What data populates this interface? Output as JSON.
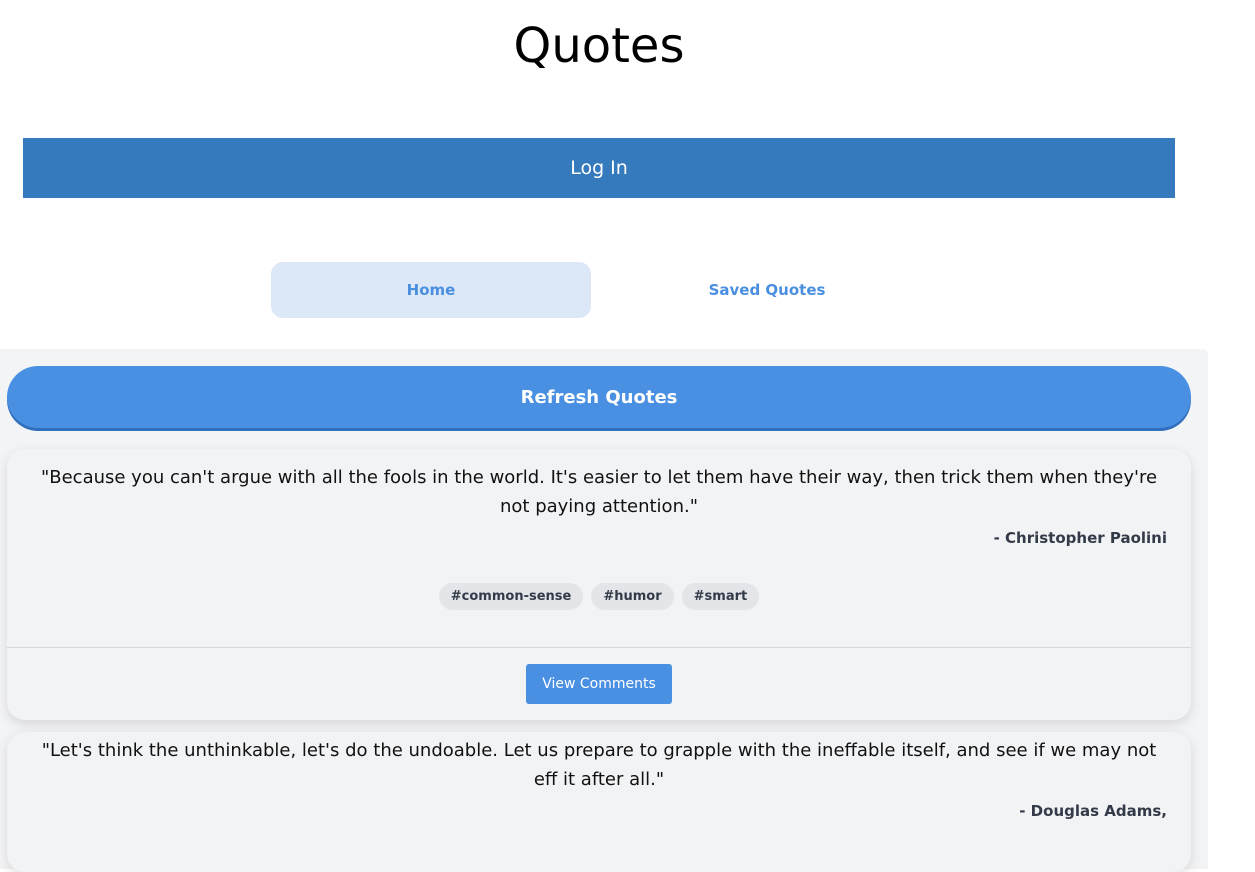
{
  "header": {
    "title": "Quotes",
    "login_label": "Log In"
  },
  "nav": {
    "tabs": [
      {
        "label": "Home",
        "active": true
      },
      {
        "label": "Saved Quotes",
        "active": false
      }
    ]
  },
  "main": {
    "refresh_label": "Refresh Quotes",
    "quotes": [
      {
        "text": "\"Because you can't argue with all the fools in the world. It's easier to let them have their way, then trick them when they're not paying attention.\"",
        "author": "- Christopher Paolini",
        "tags": [
          "#common-sense",
          "#humor",
          "#smart"
        ],
        "view_comments_label": "View Comments"
      },
      {
        "text": "\"Let's think the unthinkable, let's do the undoable. Let us prepare to grapple with the ineffable itself, and see if we may not eff it after all.\"",
        "author": "- Douglas Adams,"
      }
    ]
  },
  "colors": {
    "login_bar": "#357abd",
    "accent": "#4a90e2",
    "active_tab_bg": "#dce8f8",
    "panel_bg": "#f3f4f6"
  }
}
